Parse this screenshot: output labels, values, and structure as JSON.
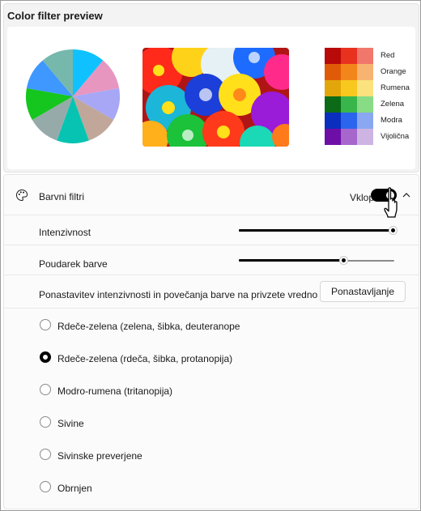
{
  "preview": {
    "title": "Color filter preview",
    "pie_colors": [
      "#0fc2ff",
      "#e796c0",
      "#a7a7f6",
      "#c0a79a",
      "#06c4b1",
      "#96aaaa",
      "#15c61e",
      "#3e98ff",
      "#77b8ad"
    ],
    "swatches": [
      {
        "label": "Red",
        "colors": [
          "#b90a0a",
          "#e8321f",
          "#f1776c"
        ]
      },
      {
        "label": "Orange",
        "colors": [
          "#e05b07",
          "#f3861b",
          "#f7b370"
        ]
      },
      {
        "label": "Rumena",
        "colors": [
          "#e3a60a",
          "#f9c81f",
          "#fbe27e"
        ]
      },
      {
        "label": "Zelena",
        "colors": [
          "#0c6b17",
          "#39b64b",
          "#88dc85"
        ]
      },
      {
        "label": "Modra",
        "colors": [
          "#0a2fbe",
          "#2b65ee",
          "#8aa7f2"
        ]
      },
      {
        "label": "Vijolična",
        "colors": [
          "#6d0fa7",
          "#a666cc",
          "#cdb4e2"
        ]
      }
    ]
  },
  "color_filters": {
    "title": "Barvni filtri",
    "toggle_label": "Vklopi",
    "toggle_on": true
  },
  "intensity": {
    "label": "Intenzivnost",
    "value": 1.0
  },
  "color_boost": {
    "label": "Poudarek barve",
    "value": 0.68
  },
  "reset": {
    "label": "Ponastavitev intenzivnosti in povečanja barve na privzete vrednosti",
    "button": "Ponastavljanje"
  },
  "filters": [
    {
      "label": "Rdeče-zelena (zelena, šibka, deuteranope",
      "checked": false
    },
    {
      "label": "Rdeče-zelena (rdeča, šibka, protanopija)",
      "checked": true
    },
    {
      "label": "Modro-rumena (tritanopija)",
      "checked": false
    },
    {
      "label": "Sivine",
      "checked": false
    },
    {
      "label": "Sivinske preverjene",
      "checked": false
    },
    {
      "label": "Obrnjen",
      "checked": false
    }
  ]
}
